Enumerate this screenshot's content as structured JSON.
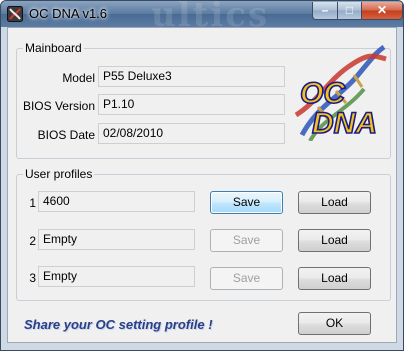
{
  "window": {
    "title": "OC DNA v1.6",
    "watermark": "ultics",
    "icon": "app-icon",
    "controls": {
      "minimize": "–",
      "maximize": "□",
      "close": "✕"
    }
  },
  "mainboard": {
    "group_label": "Mainboard",
    "rows": [
      {
        "label": "Model",
        "value": "P55 Deluxe3"
      },
      {
        "label": "BIOS Version",
        "value": "P1.10"
      },
      {
        "label": "BIOS Date",
        "value": "02/08/2010"
      }
    ]
  },
  "logo": {
    "line1": "OC",
    "line2": "DNA",
    "colors": {
      "text": "#f3c21a",
      "outline": "#1a1a8a"
    }
  },
  "profiles": {
    "group_label": "User profiles",
    "items": [
      {
        "index": "1",
        "value": "4600",
        "save": "Save",
        "load": "Load",
        "save_enabled": true
      },
      {
        "index": "2",
        "value": "Empty",
        "save": "Save",
        "load": "Load",
        "save_enabled": false
      },
      {
        "index": "3",
        "value": "Empty",
        "save": "Save",
        "load": "Load",
        "save_enabled": false
      }
    ]
  },
  "footer": {
    "slogan": "Share your OC  setting profile !",
    "ok": "OK"
  }
}
